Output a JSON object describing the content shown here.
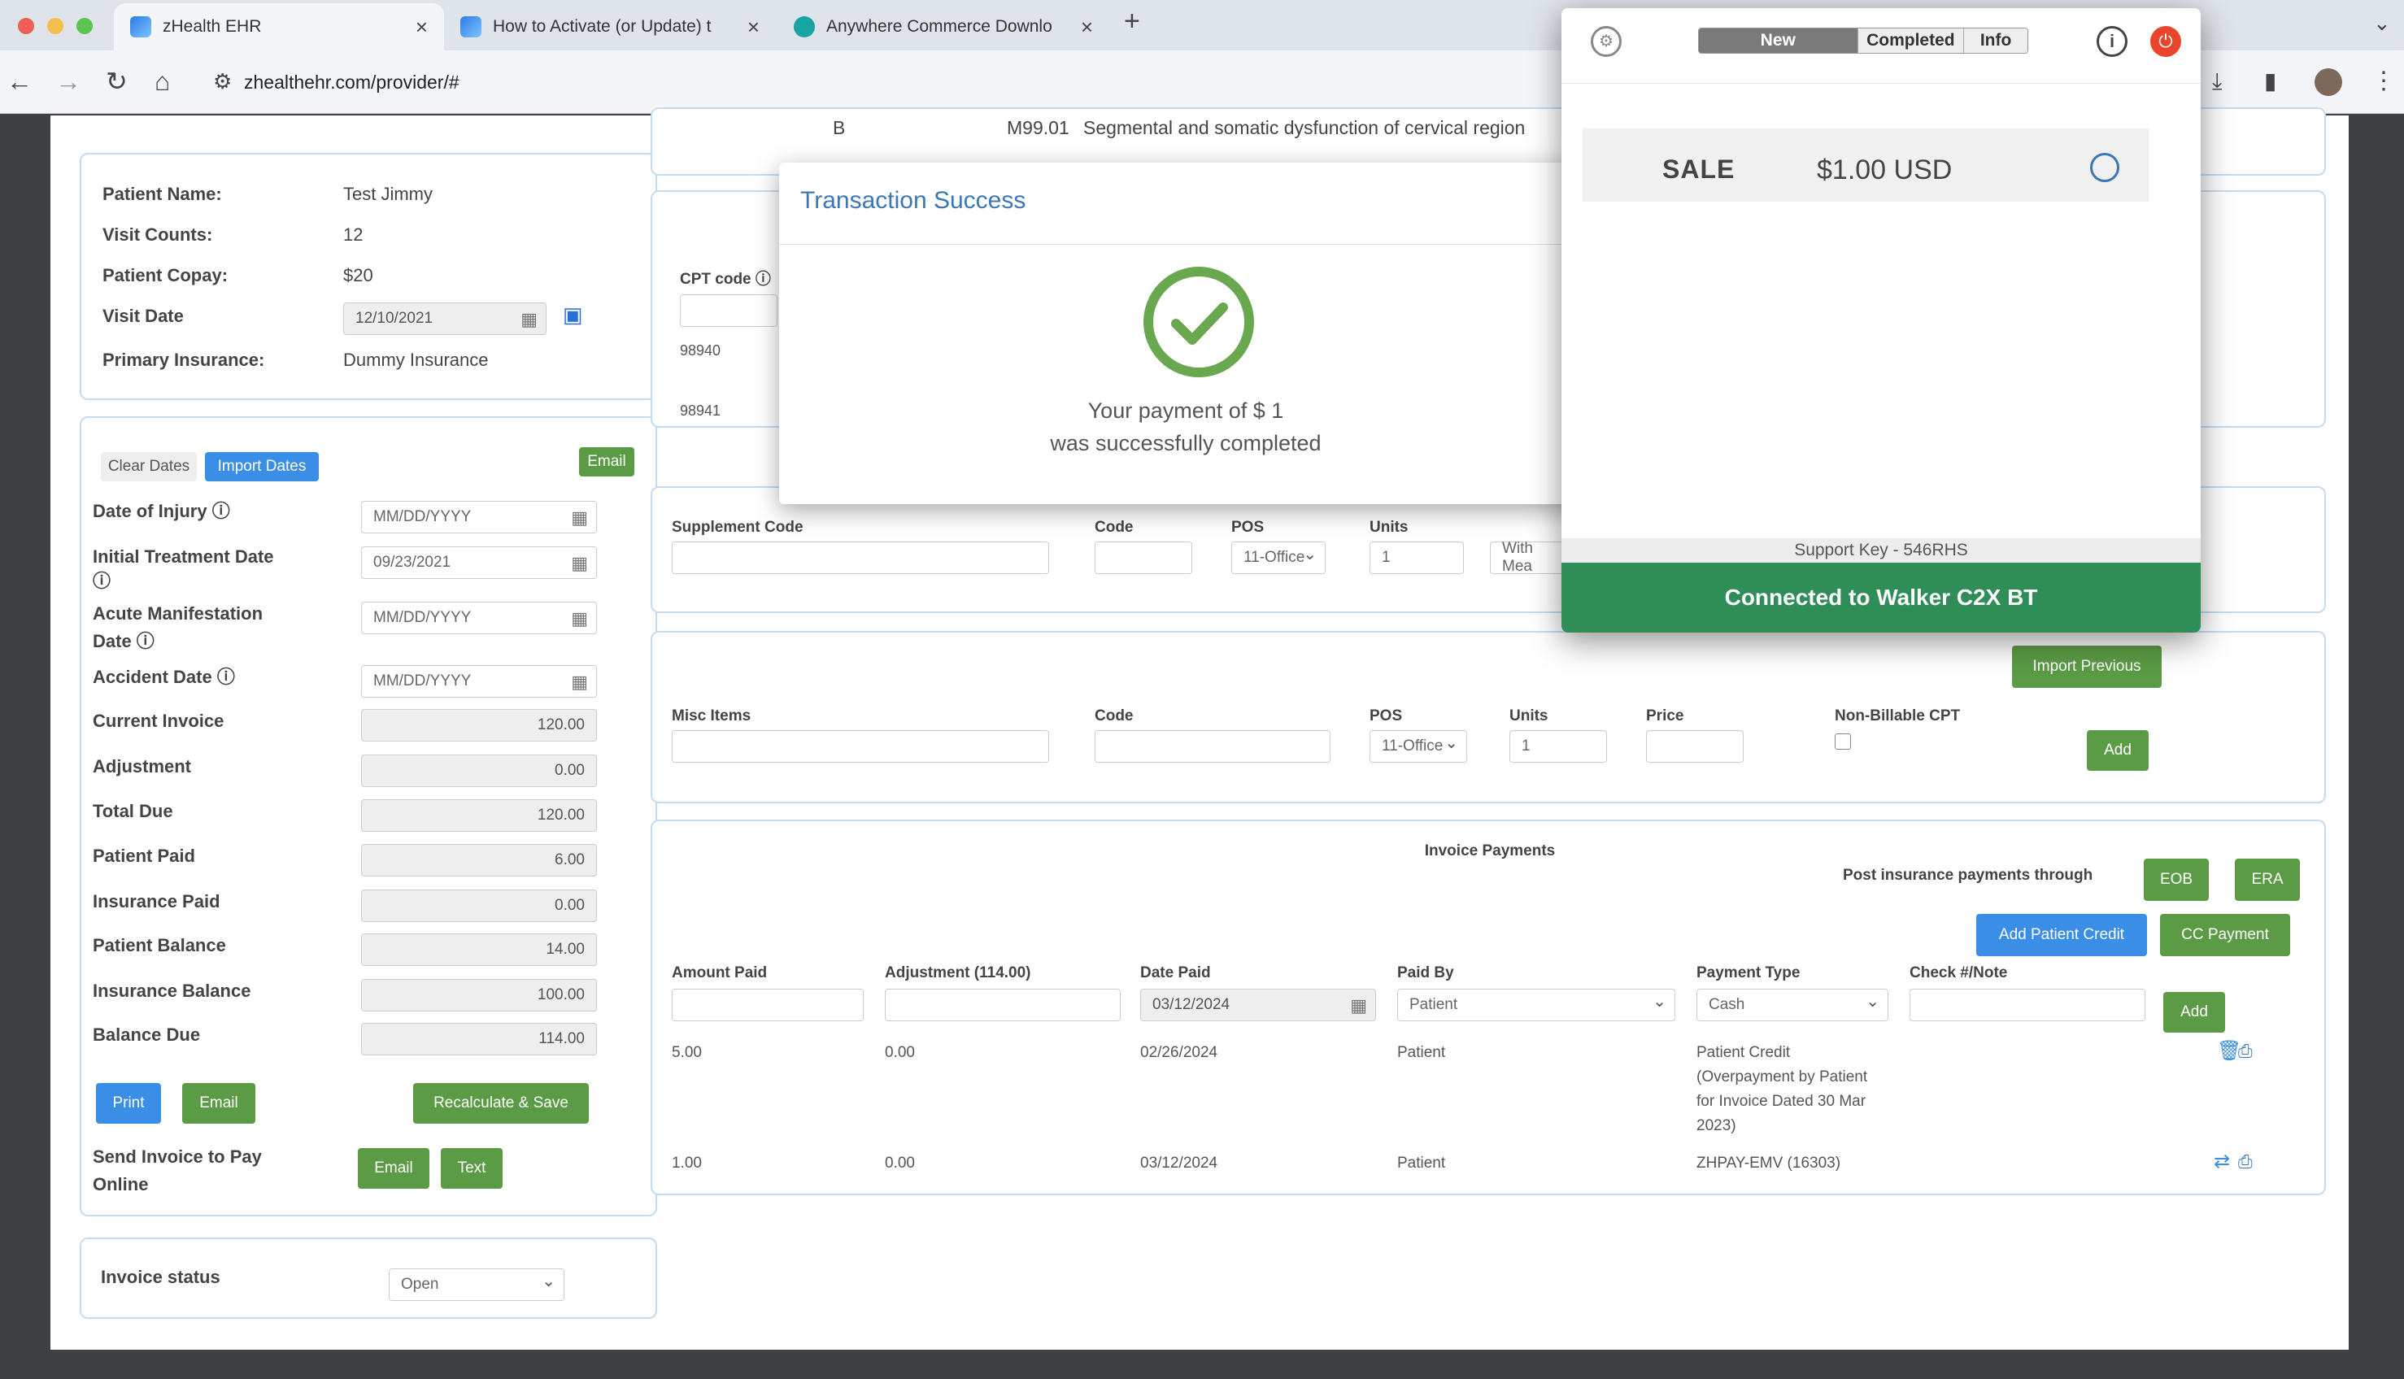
{
  "browser": {
    "tabs": [
      {
        "title": "zHealth EHR",
        "active": true,
        "icon": "zhealth-icon"
      },
      {
        "title": "How to Activate (or Update) t",
        "active": false,
        "icon": "zhealth-icon"
      },
      {
        "title": "Anywhere Commerce Downlo",
        "active": false,
        "icon": "anywhere-commerce-icon"
      }
    ],
    "url": "zhealthehr.com/provider/#"
  },
  "patient": {
    "name_label": "Patient Name:",
    "name": "Test Jimmy",
    "visits_label": "Visit Counts:",
    "visits": "12",
    "copay_label": "Patient Copay:",
    "copay": "$20",
    "visit_date_label": "Visit Date",
    "visit_date": "12/10/2021",
    "insurance_label": "Primary Insurance:",
    "insurance": "Dummy Insurance"
  },
  "dates": {
    "clear_btn": "Clear Dates",
    "import_btn": "Import Dates",
    "email_btn": "Email",
    "injury_label": "Date of Injury",
    "injury": "MM/DD/YYYY",
    "initial_label": "Initial Treatment Date",
    "initial": "09/23/2021",
    "acute_label_1": "Acute Manifestation",
    "acute_label_2": "Date",
    "acute": "MM/DD/YYYY",
    "accident_label": "Accident Date",
    "accident": "MM/DD/YYYY"
  },
  "totals": [
    {
      "label": "Current Invoice",
      "value": "120.00"
    },
    {
      "label": "Adjustment",
      "value": "0.00"
    },
    {
      "label": "Total Due",
      "value": "120.00"
    },
    {
      "label": "Patient Paid",
      "value": "6.00"
    },
    {
      "label": "Insurance Paid",
      "value": "0.00"
    },
    {
      "label": "Patient Balance",
      "value": "14.00"
    },
    {
      "label": "Insurance Balance",
      "value": "100.00"
    },
    {
      "label": "Balance Due",
      "value": "114.00"
    }
  ],
  "actions": {
    "print": "Print",
    "email": "Email",
    "recalc": "Recalculate & Save",
    "send_label_1": "Send Invoice to Pay",
    "send_label_2": "Online",
    "send_email": "Email",
    "send_text": "Text"
  },
  "status": {
    "label": "Invoice status",
    "value": "Open"
  },
  "diagnosis": {
    "letter": "B",
    "code": "M99.01",
    "desc": "Segmental and somatic dysfunction of cervical region"
  },
  "cpt": {
    "label": "CPT code",
    "codes": [
      "98940",
      "98941"
    ]
  },
  "supplement": {
    "h_supplement": "Supplement Code",
    "h_code": "Code",
    "h_pos": "POS",
    "h_units": "Units",
    "pos": "11-Office",
    "units": "1",
    "with": "With Mea"
  },
  "misc": {
    "import_prev": "Import Previous",
    "h_items": "Misc Items",
    "h_code": "Code",
    "h_pos": "POS",
    "h_units": "Units",
    "h_price": "Price",
    "h_nonbill": "Non-Billable CPT",
    "pos": "11-Office",
    "units": "1",
    "add": "Add"
  },
  "payments": {
    "title": "Invoice Payments",
    "post_label": "Post insurance payments through",
    "eob": "EOB",
    "era": "ERA",
    "add_credit": "Add Patient Credit",
    "cc_payment": "CC Payment",
    "h_amount": "Amount Paid",
    "h_adjust": "Adjustment (114.00)",
    "h_date": "Date Paid",
    "h_paidby": "Paid By",
    "h_type": "Payment Type",
    "h_check": "Check #/Note",
    "date_value": "03/12/2024",
    "paidby_value": "Patient",
    "type_value": "Cash",
    "add": "Add",
    "rows": [
      {
        "amount": "5.00",
        "adjust": "0.00",
        "date": "02/26/2024",
        "paidby": "Patient",
        "type_lines": [
          "Patient Credit",
          "(Overpayment by Patient",
          "for Invoice Dated 30 Mar",
          "2023)"
        ]
      },
      {
        "amount": "1.00",
        "adjust": "0.00",
        "date": "03/12/2024",
        "paidby": "Patient",
        "type_lines": [
          "ZHPAY-EMV (16303)"
        ]
      }
    ]
  },
  "modal": {
    "title": "Transaction Success",
    "msg_line1": "Your payment of $ 1",
    "msg_line2": "was successfully completed"
  },
  "extension": {
    "tabs": [
      "New",
      "Completed",
      "Info"
    ],
    "sale_label": "SALE",
    "sale_amount": "$1.00 USD",
    "support_key": "Support Key - 546RHS",
    "status": "Connected to Walker C2X BT",
    "colors": {
      "status_bg": "#2f8e57",
      "power": "#e8452c"
    }
  }
}
